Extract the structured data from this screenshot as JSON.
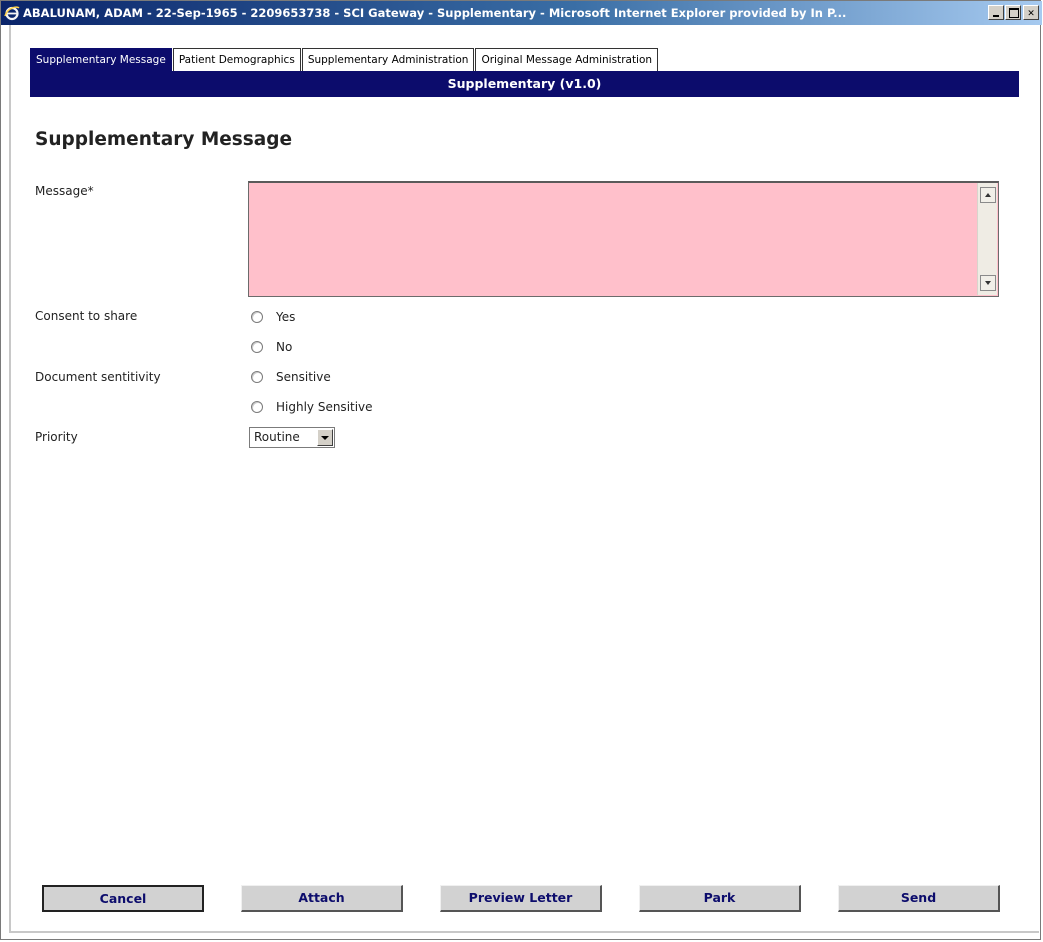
{
  "window": {
    "title": "ABALUNAM, ADAM - 22-Sep-1965 - 2209653738 - SCI Gateway - Supplementary - Microsoft Internet Explorer provided by In P..."
  },
  "tabs": [
    {
      "label": "Supplementary Message",
      "active": true
    },
    {
      "label": "Patient Demographics",
      "active": false
    },
    {
      "label": "Supplementary Administration",
      "active": false
    },
    {
      "label": "Original Message Administration",
      "active": false
    }
  ],
  "header": {
    "title": "Supplementary (v1.0)"
  },
  "form": {
    "title": "Supplementary Message",
    "message": {
      "label": "Message*",
      "value": ""
    },
    "consent": {
      "label": "Consent to share",
      "options": [
        "Yes",
        "No"
      ]
    },
    "sensitivity": {
      "label": "Document sentitivity",
      "options": [
        "Sensitive",
        "Highly Sensitive"
      ]
    },
    "priority": {
      "label": "Priority",
      "value": "Routine"
    }
  },
  "buttons": {
    "cancel": "Cancel",
    "attach": "Attach",
    "preview": "Preview Letter",
    "park": "Park",
    "send": "Send"
  },
  "colors": {
    "header_bg": "#0c0c6c",
    "message_bg": "#ffc0cb",
    "button_text": "#0c0c6c"
  },
  "icons": [
    "ie-icon",
    "minimize-icon",
    "maximize-icon",
    "close-icon",
    "scroll-up-icon",
    "scroll-down-icon",
    "dropdown-arrow-icon"
  ]
}
